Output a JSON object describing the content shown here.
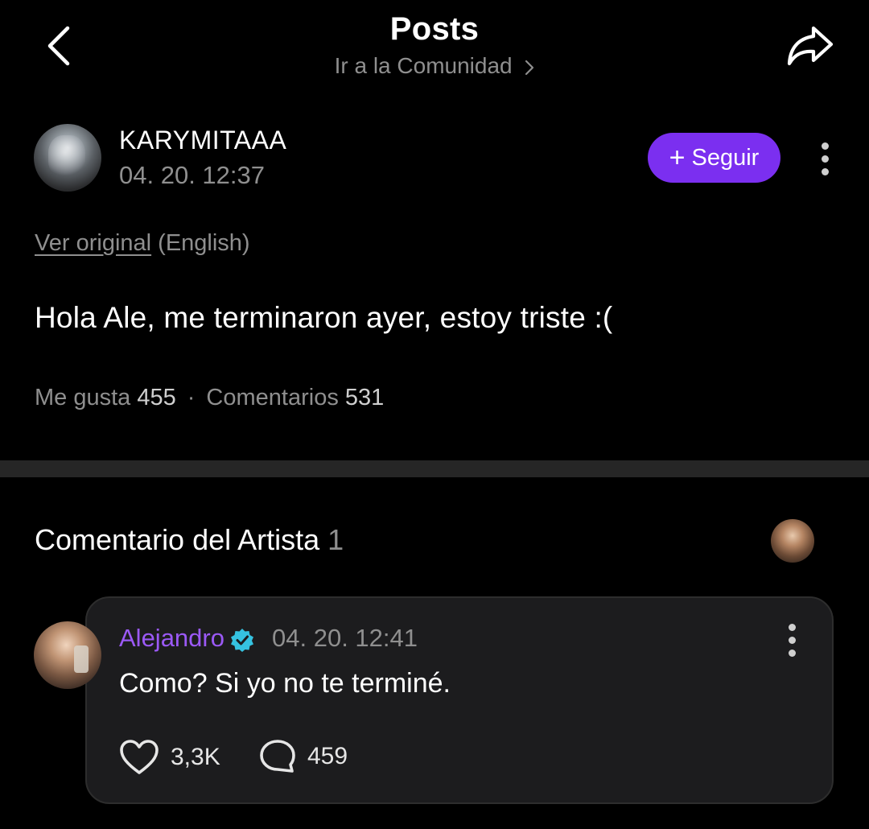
{
  "header": {
    "title": "Posts",
    "community_link": "Ir a la Comunidad"
  },
  "post": {
    "author": "KARYMITAAA",
    "time": "04. 20. 12:37",
    "follow_label": "Seguir",
    "translate_link": "Ver original",
    "translate_lang": "(English)",
    "body": "Hola Ale, me terminaron ayer, estoy triste :(",
    "likes_label": "Me gusta",
    "likes_count": "455",
    "comments_label": "Comentarios",
    "comments_count": "531"
  },
  "artist_section": {
    "title": "Comentario del Artista",
    "count": "1"
  },
  "comment": {
    "author": "Alejandro",
    "time": "04. 20. 12:41",
    "text": "Como? Si yo no te terminé.",
    "likes": "3,3K",
    "replies": "459"
  },
  "colors": {
    "accent": "#7b2ff0",
    "artist_name": "#9b59f6",
    "verified": "#35c2e0",
    "card_bg": "#1c1c1e"
  },
  "icons": [
    "back-icon",
    "share-icon",
    "chevron-right-icon",
    "plus-icon",
    "more-vertical-icon",
    "verified-icon",
    "heart-icon",
    "comment-bubble-icon"
  ]
}
